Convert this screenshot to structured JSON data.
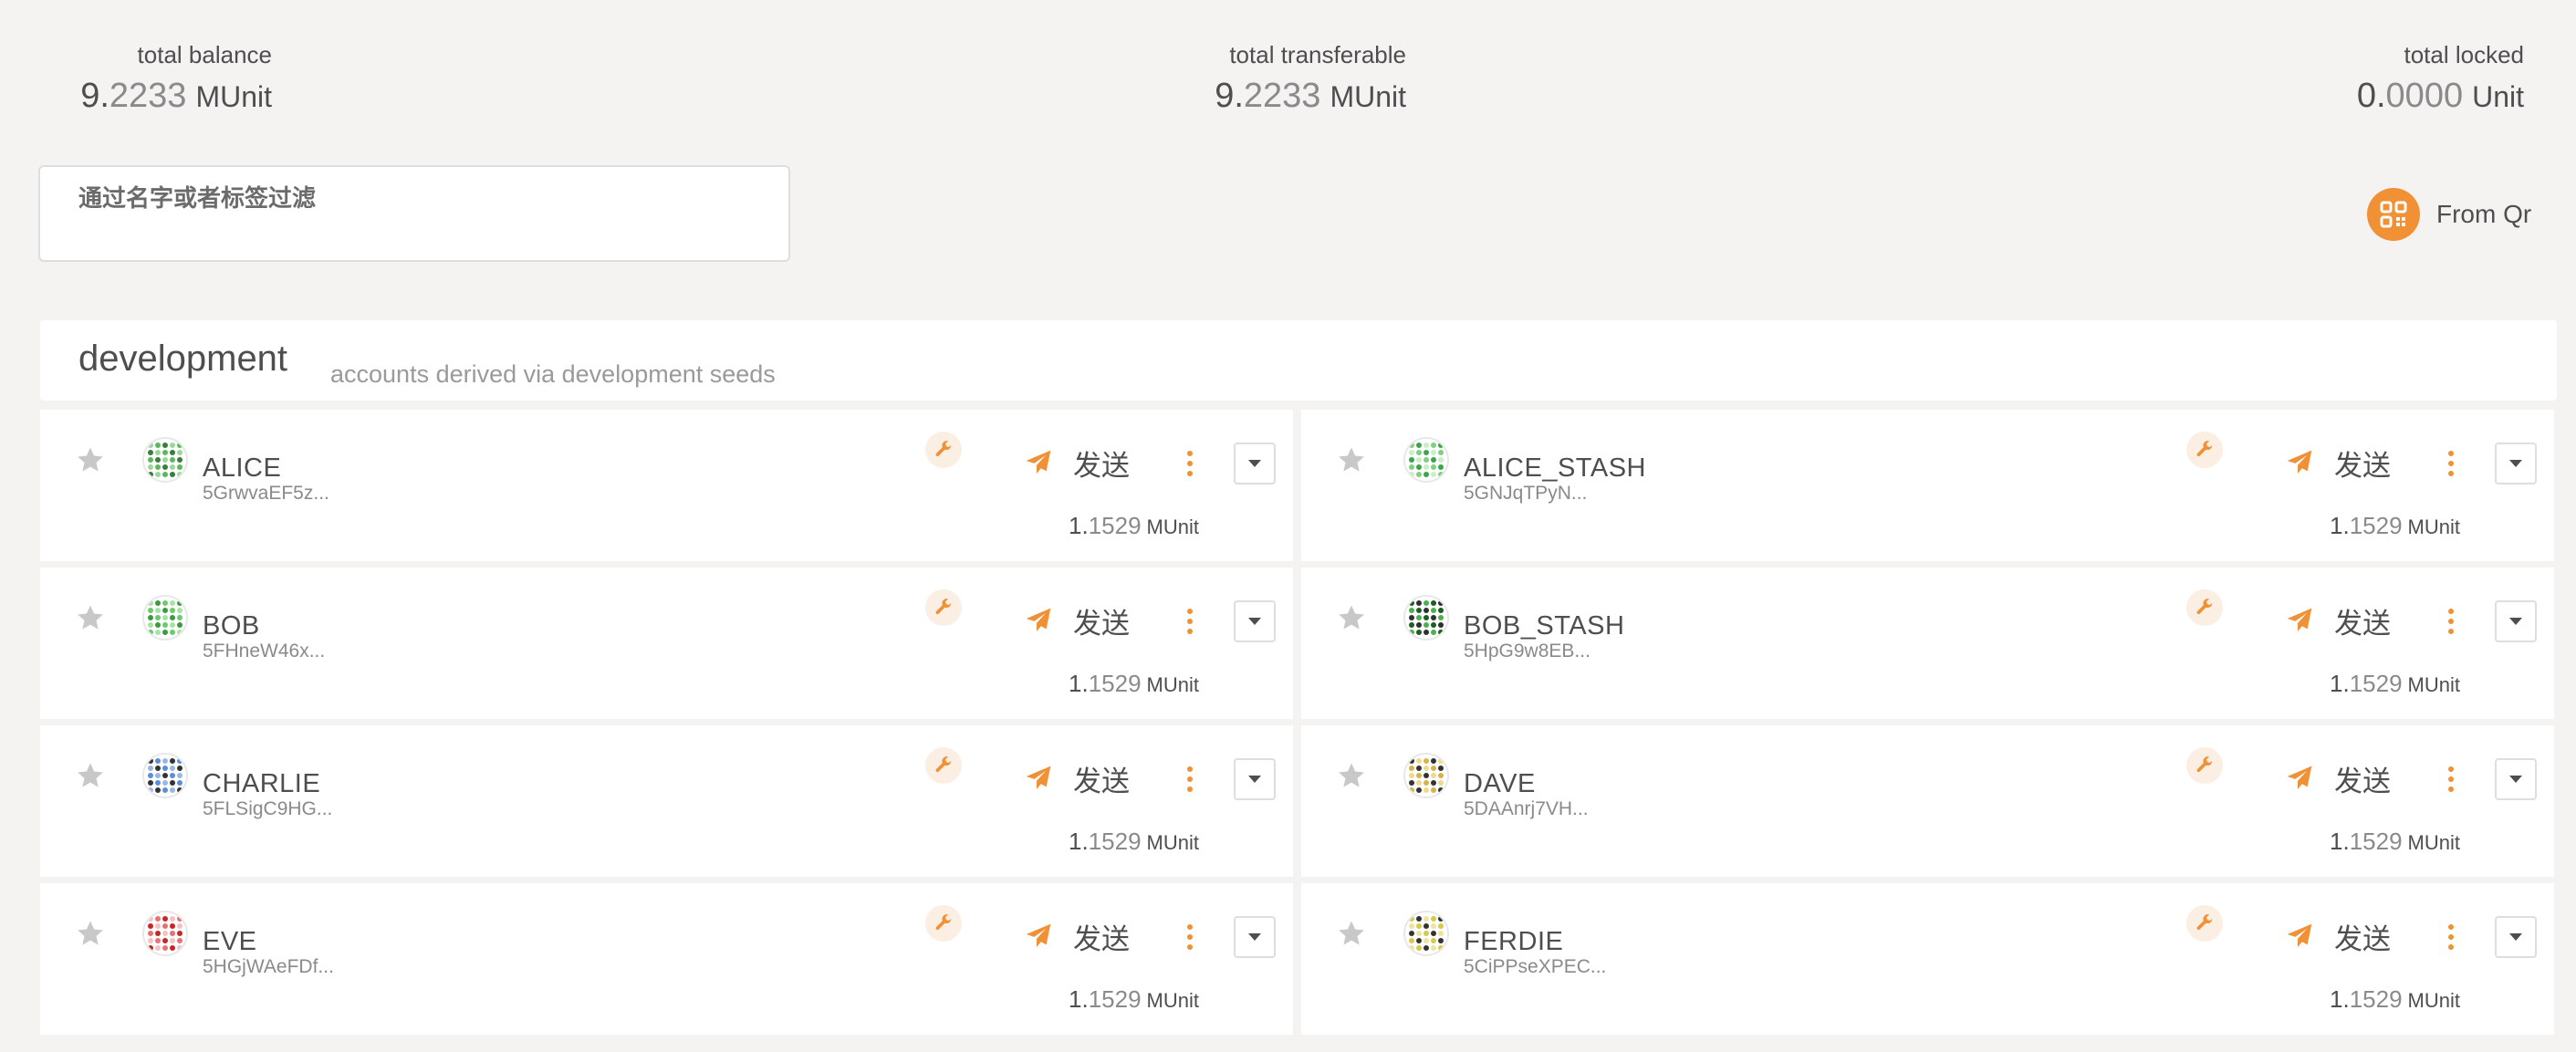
{
  "summary": {
    "total_balance": {
      "label": "total balance",
      "int": "9.",
      "dec": "2233",
      "unit": "MUnit"
    },
    "total_transferable": {
      "label": "total transferable",
      "int": "9.",
      "dec": "2233",
      "unit": "MUnit"
    },
    "total_locked": {
      "label": "total locked",
      "int": "0.",
      "dec": "0000",
      "unit": "Unit"
    }
  },
  "filter": {
    "label": "通过名字或者标签过滤",
    "value": ""
  },
  "from_qr": {
    "label": "From Qr",
    "color": "#f19135"
  },
  "group": {
    "title": "development",
    "description": "accounts derived via development seeds"
  },
  "send_label": "发送",
  "accent": "#f19135",
  "accounts": [
    {
      "name": "ALICE",
      "address": "5GrwvaEF5z...",
      "int": "1.",
      "dec": "1529",
      "unit": "MUnit",
      "identicon": "green"
    },
    {
      "name": "ALICE_STASH",
      "address": "5GNJqTPyN...",
      "int": "1.",
      "dec": "1529",
      "unit": "MUnit",
      "identicon": "green-light"
    },
    {
      "name": "BOB",
      "address": "5FHneW46x...",
      "int": "1.",
      "dec": "1529",
      "unit": "MUnit",
      "identicon": "green-grid"
    },
    {
      "name": "BOB_STASH",
      "address": "5HpG9w8EB...",
      "int": "1.",
      "dec": "1529",
      "unit": "MUnit",
      "identicon": "dark-green"
    },
    {
      "name": "CHARLIE",
      "address": "5FLSigC9HG...",
      "int": "1.",
      "dec": "1529",
      "unit": "MUnit",
      "identicon": "blue-dark"
    },
    {
      "name": "DAVE",
      "address": "5DAAnrj7VH...",
      "int": "1.",
      "dec": "1529",
      "unit": "MUnit",
      "identicon": "gold-dark"
    },
    {
      "name": "EVE",
      "address": "5HGjWAeFDf...",
      "int": "1.",
      "dec": "1529",
      "unit": "MUnit",
      "identicon": "red"
    },
    {
      "name": "FERDIE",
      "address": "5CiPPseXPEC...",
      "int": "1.",
      "dec": "1529",
      "unit": "MUnit",
      "identicon": "yellow-dark"
    }
  ]
}
